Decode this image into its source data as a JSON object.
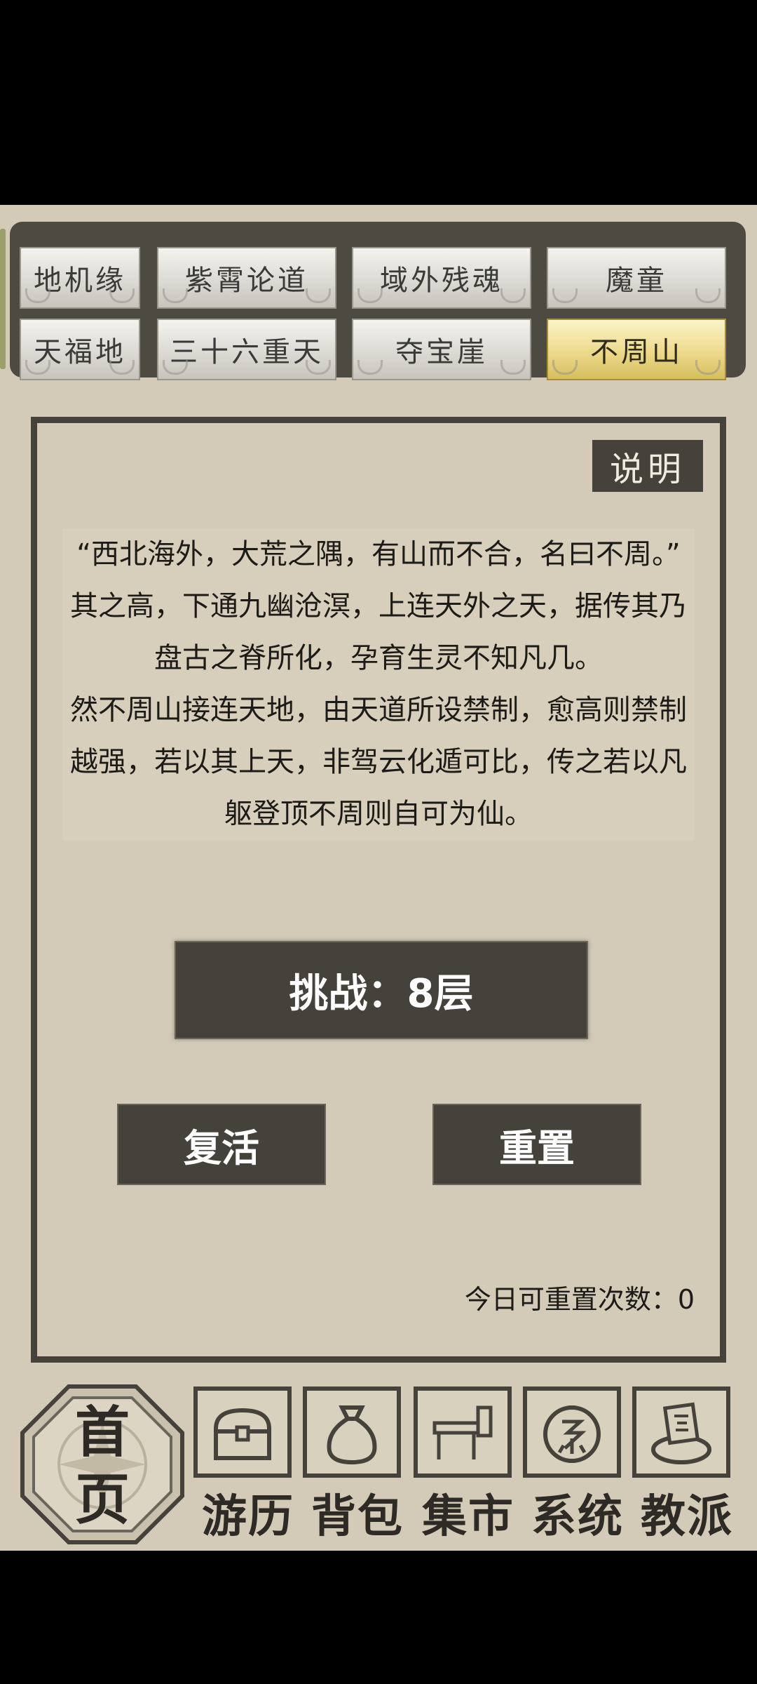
{
  "tabs": [
    {
      "label": "地机缘",
      "selected": false
    },
    {
      "label": "紫霄论道",
      "selected": false
    },
    {
      "label": "域外残魂",
      "selected": false
    },
    {
      "label": "魔童",
      "selected": false
    },
    {
      "label": "天福地",
      "selected": false
    },
    {
      "label": "三十六重天",
      "selected": false
    },
    {
      "label": "夺宝崖",
      "selected": false
    },
    {
      "label": "不周山",
      "selected": true
    }
  ],
  "panel": {
    "help_label": "说明",
    "description": [
      "“西北海外，大荒之隅，有山而不合，名曰不周。”",
      "其之高，下通九幽沧溟，上连天外之天，据传其乃盘古之脊所化，孕育生灵不知凡几。",
      "然不周山接连天地，由天道所设禁制，愈高则禁制越强，若以其上天，非驾云化遁可比，传之若以凡躯登顶不周则自可为仙。"
    ],
    "challenge_label": "挑战：8层",
    "revive_label": "复活",
    "reset_label": "重置",
    "reset_count_text": "今日可重置次数：0"
  },
  "nav": {
    "home_label": "首页",
    "items": [
      {
        "label": "游历",
        "icon": "chest-icon"
      },
      {
        "label": "背包",
        "icon": "bag-icon"
      },
      {
        "label": "集市",
        "icon": "stall-icon"
      },
      {
        "label": "系统",
        "icon": "system-seal-icon"
      },
      {
        "label": "教派",
        "icon": "sect-banner-icon"
      }
    ]
  },
  "colors": {
    "background": "#d3cbb7",
    "dark": "#45423c",
    "tab_selected": "#ecd98a"
  }
}
